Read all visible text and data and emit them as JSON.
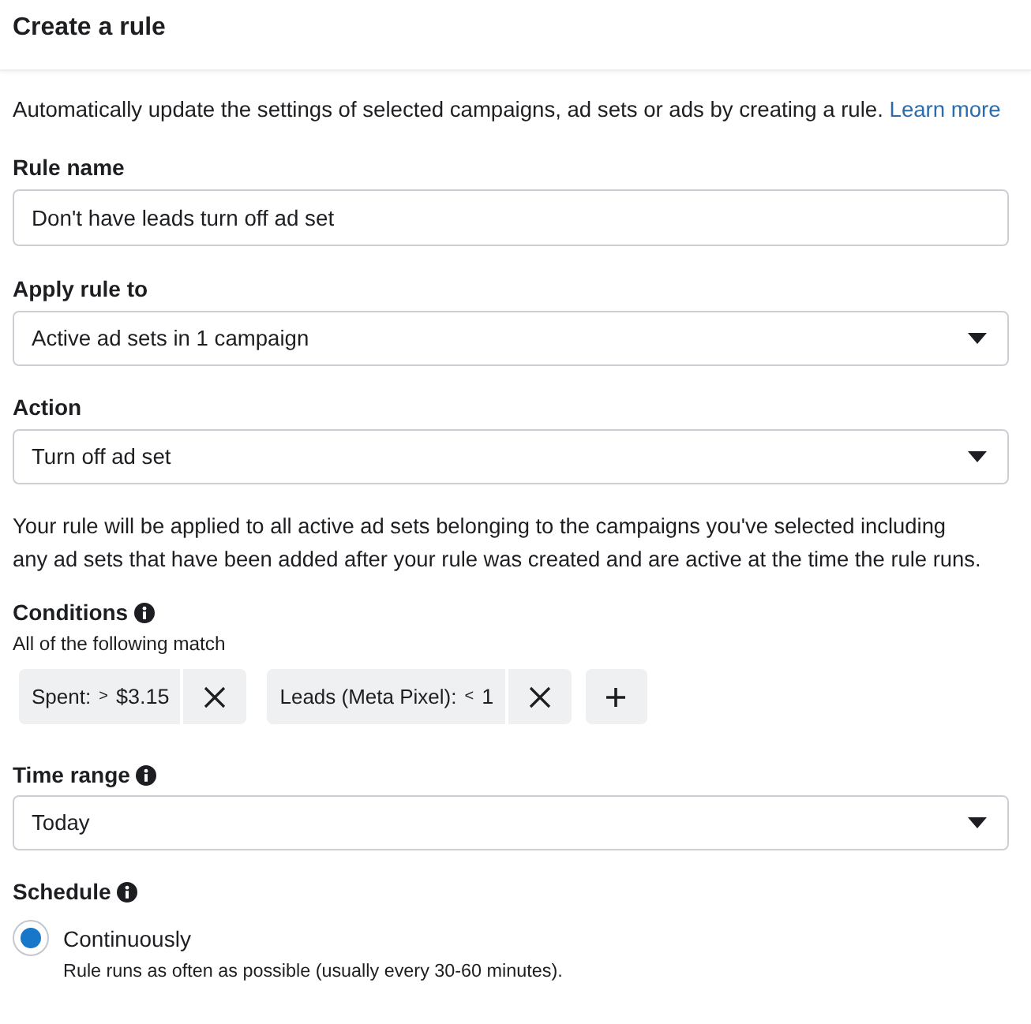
{
  "header": {
    "title": "Create a rule"
  },
  "intro": {
    "text": "Automatically update the settings of selected campaigns, ad sets or ads by creating a rule.",
    "link": "Learn more"
  },
  "rule_name": {
    "label": "Rule name",
    "value": "Don't have leads turn off ad set"
  },
  "apply_rule_to": {
    "label": "Apply rule to",
    "value": "Active ad sets in 1 campaign"
  },
  "action": {
    "label": "Action",
    "value": "Turn off ad set"
  },
  "note": "Your rule will be applied to all active ad sets belonging to the campaigns you've selected including any ad sets that have been added after your rule was created and are active at the time the rule runs.",
  "conditions": {
    "label": "Conditions",
    "info": true,
    "subtitle": "All of the following match",
    "items": [
      {
        "field": "Spent:",
        "operator": ">",
        "value": "$3.15"
      },
      {
        "field": "Leads (Meta Pixel):",
        "operator": "<",
        "value": "1"
      }
    ]
  },
  "time_range": {
    "label": "Time range",
    "info": true,
    "value": "Today"
  },
  "schedule": {
    "label": "Schedule",
    "info": true,
    "options": [
      {
        "label": "Continuously",
        "description": "Rule runs as often as possible (usually every 30-60 minutes).",
        "selected": true
      }
    ]
  }
}
